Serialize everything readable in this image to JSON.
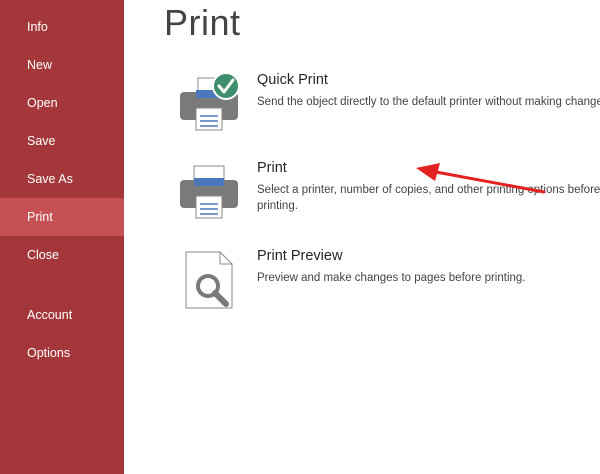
{
  "sidebar": {
    "items": [
      {
        "label": "Info"
      },
      {
        "label": "New"
      },
      {
        "label": "Open"
      },
      {
        "label": "Save"
      },
      {
        "label": "Save As"
      },
      {
        "label": "Print",
        "active": true
      },
      {
        "label": "Close"
      },
      {
        "label": "Account"
      },
      {
        "label": "Options"
      }
    ]
  },
  "main": {
    "title": "Print",
    "options": [
      {
        "label": "Quick Print",
        "description": "Send the object directly to the default printer without making changes.",
        "icon": "quick-print-icon"
      },
      {
        "label": "Print",
        "description": "Select a printer, number of copies, and other printing options before printing.",
        "icon": "printer-icon"
      },
      {
        "label": "Print Preview",
        "description": "Preview and make changes to pages before printing.",
        "icon": "print-preview-icon"
      }
    ]
  },
  "colors": {
    "sidebar": "#a4373a",
    "sidebar_active": "#c75054",
    "accent_check": "#3e8e6e",
    "annotation_arrow": "#e52222"
  }
}
